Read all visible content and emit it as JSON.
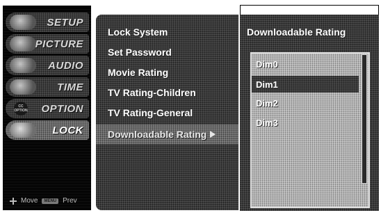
{
  "left_menu": {
    "items": [
      {
        "label": "SETUP",
        "icon": "setup-icon"
      },
      {
        "label": "PICTURE",
        "icon": "picture-icon"
      },
      {
        "label": "AUDIO",
        "icon": "audio-icon"
      },
      {
        "label": "TIME",
        "icon": "time-icon"
      },
      {
        "label": "OPTION",
        "icon": "option-icon"
      },
      {
        "label": "LOCK",
        "icon": "lock-icon"
      }
    ],
    "option_icon_text": "CC OPTION"
  },
  "footer": {
    "move_label": "Move",
    "menu_key_label": "MENU",
    "prev_label": "Prev"
  },
  "submenu": {
    "items": [
      "Lock System",
      "Set Password",
      "Movie Rating",
      "TV Rating-Children",
      "TV Rating-General",
      "Downloadable Rating"
    ],
    "active_index": 5
  },
  "right_panel": {
    "title": "Downloadable Rating",
    "options": [
      "Dim0",
      "Dim1",
      "Dim2",
      "Dim3"
    ],
    "selected_index": 1
  }
}
